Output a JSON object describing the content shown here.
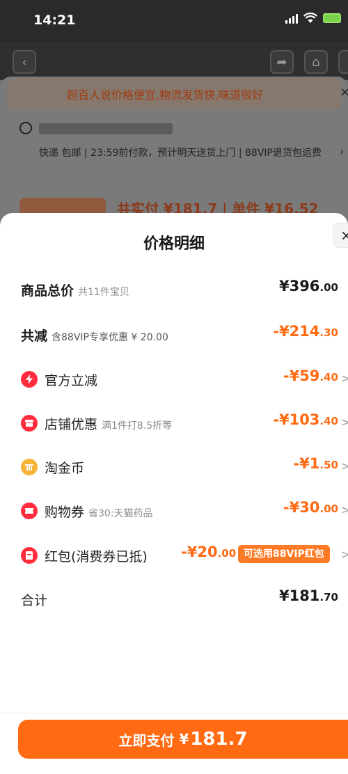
{
  "status_bar": {
    "time": "14:21"
  },
  "background": {
    "tip_text": "超百人说价格便宜,物流发货快,味道很好",
    "delivery_text": "快递 包邮 | 23:59前付款，预计明天送货上门 | 88VIP退货包运费",
    "pay_text": "共实付 ¥181.7 | 单件 ¥16.52"
  },
  "modal": {
    "title": "价格明细",
    "close_symbol": "×",
    "rows": {
      "total": {
        "label": "商品总价",
        "sub": "共11件宝贝",
        "currency": "¥",
        "int": "396",
        "dec": ".00"
      },
      "reduce": {
        "label": "共减",
        "sub": "含88VIP专享优惠 ¥ 20.00",
        "prefix": "-¥",
        "int": "214",
        "dec": ".30"
      },
      "official": {
        "label": "官方立减",
        "prefix": "-¥",
        "int": "59",
        "dec": ".40",
        "icon": "lightning-icon"
      },
      "shop": {
        "label": "店铺优惠",
        "sub": "满1件打8.5折等",
        "prefix": "-¥",
        "int": "103",
        "dec": ".40",
        "icon": "shop-icon"
      },
      "coin": {
        "label": "淘金币",
        "prefix": "-¥",
        "int": "1",
        "dec": ".50",
        "icon": "coin-icon"
      },
      "voucher": {
        "label": "购物券",
        "sub": "省30:天猫药品",
        "prefix": "-¥",
        "int": "30",
        "dec": ".00",
        "icon": "ticket-icon"
      },
      "redpacket": {
        "label": "红包(消费券已抵)",
        "prefix": "-¥",
        "int": "20",
        "dec": ".00",
        "badge": "可选用88VIP红包",
        "icon": "red-packet-icon"
      },
      "sum": {
        "label": "合计",
        "currency": "¥",
        "int": "181",
        "dec": ".70"
      }
    },
    "chevron": ">"
  },
  "pay_button": {
    "label": "立即支付",
    "currency": "¥",
    "amount": "181.7"
  },
  "colors": {
    "accent": "#ff6a13",
    "red_icon": "#ff2d3d",
    "gold_icon": "#f5b437"
  }
}
